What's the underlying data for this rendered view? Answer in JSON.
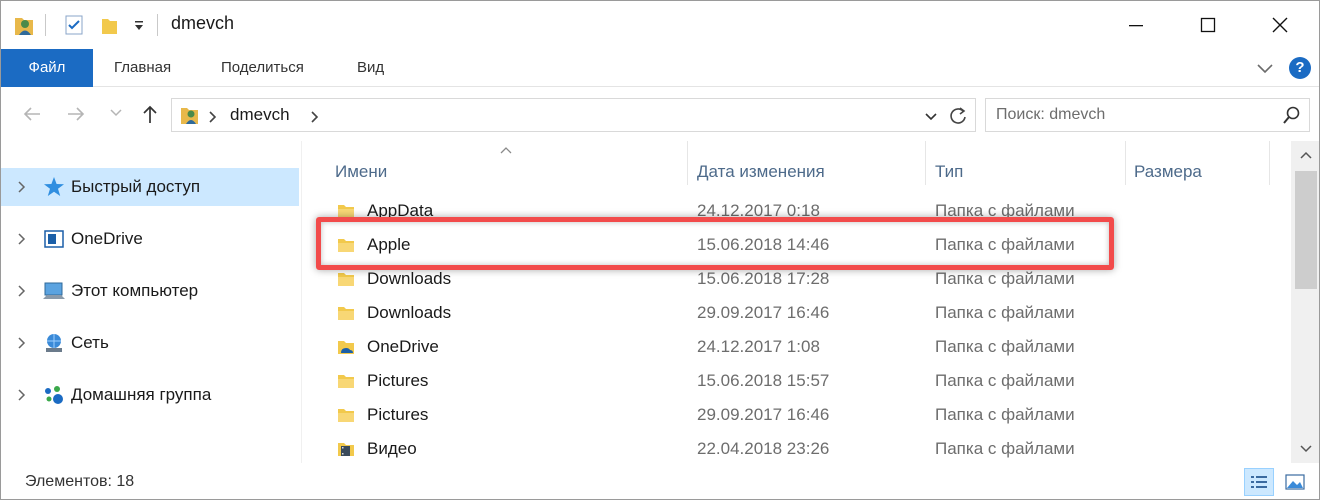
{
  "window": {
    "title": "dmevch",
    "controls": {
      "minimize": "minimize-icon",
      "maximize": "maximize-icon",
      "close": "close-icon"
    }
  },
  "ribbon": {
    "tabs": [
      {
        "label": "Файл",
        "active": true
      },
      {
        "label": "Главная"
      },
      {
        "label": "Поделиться"
      },
      {
        "label": "Вид"
      }
    ],
    "help": "?"
  },
  "address": {
    "segments": [
      "dmevch"
    ],
    "search_placeholder": "Поиск: dmevch"
  },
  "nav_pane": {
    "items": [
      {
        "label": "Быстрый доступ",
        "icon": "star-icon",
        "selected": true
      },
      {
        "label": "OneDrive",
        "icon": "onedrive-icon"
      },
      {
        "label": "Этот компьютер",
        "icon": "computer-icon"
      },
      {
        "label": "Сеть",
        "icon": "network-icon"
      },
      {
        "label": "Домашняя группа",
        "icon": "homegroup-icon"
      }
    ]
  },
  "columns": {
    "name": "Имени",
    "date": "Дата изменения",
    "type": "Тип",
    "size": "Размера"
  },
  "files": [
    {
      "name": "AppData",
      "date": "24.12.2017 0:18",
      "type": "Папка с файлами",
      "icon": "folder-icon"
    },
    {
      "name": "Apple",
      "date": "15.06.2018 14:46",
      "type": "Папка с файлами",
      "icon": "folder-icon",
      "highlighted": true
    },
    {
      "name": "Downloads",
      "date": "15.06.2018 17:28",
      "type": "Папка с файлами",
      "icon": "folder-icon"
    },
    {
      "name": "Downloads",
      "date": "29.09.2017 16:46",
      "type": "Папка с файлами",
      "icon": "folder-icon"
    },
    {
      "name": "OneDrive",
      "date": "24.12.2017 1:08",
      "type": "Папка с файлами",
      "icon": "onedrive-folder-icon"
    },
    {
      "name": "Pictures",
      "date": "15.06.2018 15:57",
      "type": "Папка с файлами",
      "icon": "folder-icon"
    },
    {
      "name": "Pictures",
      "date": "29.09.2017 16:46",
      "type": "Папка с файлами",
      "icon": "folder-icon"
    },
    {
      "name": "Видео",
      "date": "22.04.2018 23:26",
      "type": "Папка с файлами",
      "icon": "video-folder-icon"
    }
  ],
  "status": {
    "items_count": "Элементов: 18"
  },
  "colors": {
    "accent": "#1b6bc3",
    "selection": "#cce8ff",
    "highlight_border": "#f24b4b"
  }
}
